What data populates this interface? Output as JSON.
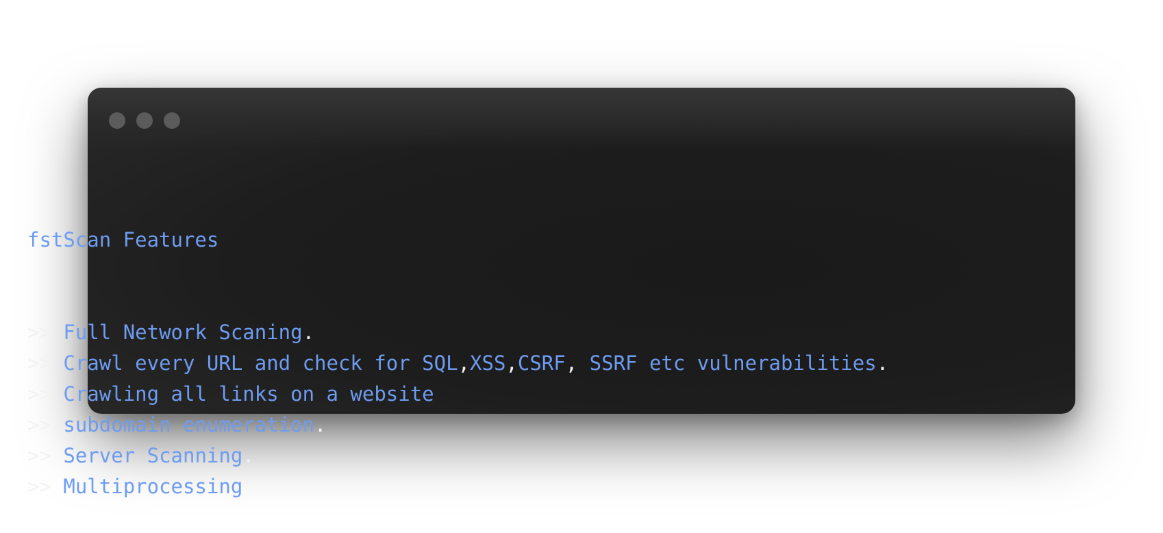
{
  "window": {
    "controls": [
      "close-dot",
      "minimize-dot",
      "zoom-dot"
    ]
  },
  "colors": {
    "background": "#ffffff",
    "terminal": "#1d1d1d",
    "keyword": "#6e9cf0",
    "plain": "#f2f2f2",
    "control_dot": "#5b5b5b"
  },
  "code": {
    "title": "fstScan Features",
    "prompt": ">> ",
    "lines": [
      {
        "segments": [
          {
            "text": "Full Network Scaning",
            "style": "hl"
          },
          {
            "text": ".",
            "style": "pl"
          }
        ]
      },
      {
        "segments": [
          {
            "text": "Crawl every URL and check for SQL",
            "style": "hl"
          },
          {
            "text": ",",
            "style": "pl"
          },
          {
            "text": "XSS",
            "style": "hl"
          },
          {
            "text": ",",
            "style": "pl"
          },
          {
            "text": "CSRF",
            "style": "hl"
          },
          {
            "text": ", ",
            "style": "pl"
          },
          {
            "text": "SSRF etc vulnerabilities",
            "style": "hl"
          },
          {
            "text": ".",
            "style": "pl"
          }
        ]
      },
      {
        "segments": [
          {
            "text": "Crawling all links on a website",
            "style": "hl"
          }
        ]
      },
      {
        "segments": [
          {
            "text": "subdomain enumeration",
            "style": "hl"
          },
          {
            "text": ".",
            "style": "pl"
          }
        ]
      },
      {
        "segments": [
          {
            "text": "Server Scanning",
            "style": "hl"
          },
          {
            "text": ".",
            "style": "pl"
          }
        ]
      },
      {
        "segments": [
          {
            "text": "Multiprocessing",
            "style": "hl"
          }
        ]
      }
    ]
  }
}
